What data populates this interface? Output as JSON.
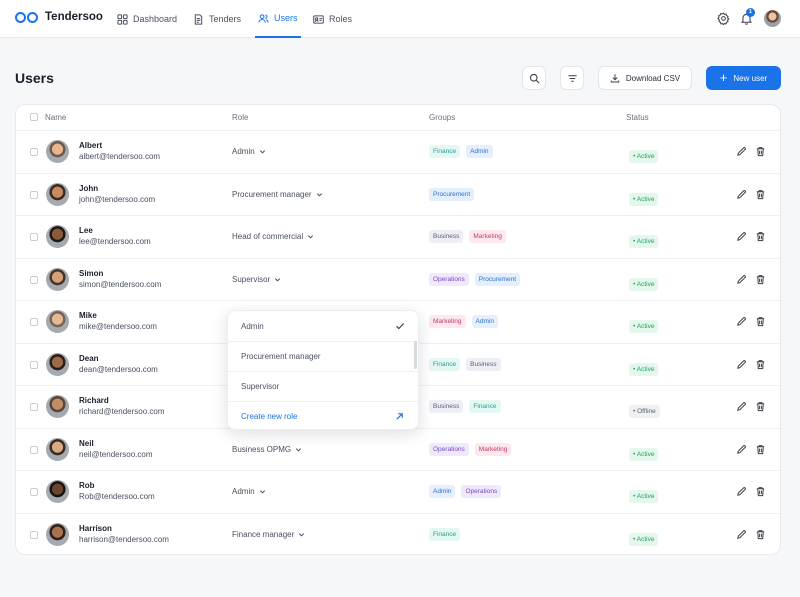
{
  "app": {
    "name": "Tendersoo"
  },
  "nav": [
    {
      "label": "Dashboard",
      "icon": "dashboard-grid-icon",
      "active": false
    },
    {
      "label": "Tenders",
      "icon": "document-icon",
      "active": false
    },
    {
      "label": "Users",
      "icon": "users-icon",
      "active": true
    },
    {
      "label": "Roles",
      "icon": "id-card-icon",
      "active": false
    }
  ],
  "topbar": {
    "notification_count": "1",
    "accent": "#1a73e8"
  },
  "page": {
    "title": "Users",
    "download_label": "Download CSV",
    "new_user_label": "New user"
  },
  "table": {
    "headers": {
      "name": "Name",
      "role": "Role",
      "groups": "Groups",
      "status": "Status"
    },
    "rows": [
      {
        "name": "Albert",
        "email": "albert@tendersoo.com",
        "role": "Admin",
        "groups": [
          "Finance",
          "Admin"
        ],
        "status": "Active"
      },
      {
        "name": "John",
        "email": "john@tendersoo.com",
        "role": "Procurement manager",
        "groups": [
          "Procurement"
        ],
        "status": "Active"
      },
      {
        "name": "Lee",
        "email": "lee@tendersoo.com",
        "role": "Head of commercial",
        "groups": [
          "Business",
          "Marketing"
        ],
        "status": "Active"
      },
      {
        "name": "Simon",
        "email": "simon@tendersoo.com",
        "role": "Supervisor",
        "groups": [
          "Operations",
          "Procurement"
        ],
        "status": "Active"
      },
      {
        "name": "Mike",
        "email": "mike@tendersoo.com",
        "role": "",
        "groups": [
          "Marketing",
          "Admin"
        ],
        "status": "Active"
      },
      {
        "name": "Dean",
        "email": "dean@tendersoo.com",
        "role": "",
        "groups": [
          "Finance",
          "Business"
        ],
        "status": "Active"
      },
      {
        "name": "Richard",
        "email": "richard@tendersoo.com",
        "role": "",
        "groups": [
          "Business",
          "Finance"
        ],
        "status": "Offline"
      },
      {
        "name": "Neil",
        "email": "neil@tendersoo.com",
        "role": "Business OPMG",
        "groups": [
          "Operations",
          "Marketing"
        ],
        "status": "Active"
      },
      {
        "name": "Rob",
        "email": "Rob@tendersoo.com",
        "role": "Admin",
        "groups": [
          "Admin",
          "Operations"
        ],
        "status": "Active"
      },
      {
        "name": "Harrison",
        "email": "harrison@tendersoo.com",
        "role": "Finance manager",
        "groups": [
          "Finance"
        ],
        "status": "Active"
      }
    ]
  },
  "role_dropdown": {
    "options": [
      "Admin",
      "Procurement manager",
      "Supervisor"
    ],
    "selected": "Admin",
    "create_label": "Create new role"
  }
}
